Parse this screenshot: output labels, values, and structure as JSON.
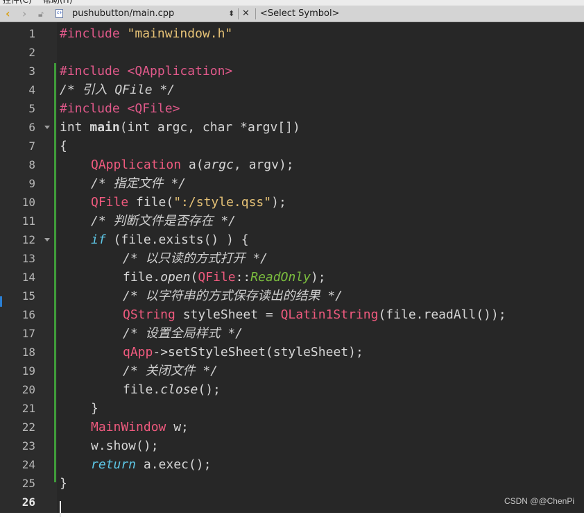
{
  "menu": [
    "控件(C)",
    "帮助(H)"
  ],
  "toolbar": {
    "file_name": "pushubutton/main.cpp",
    "symbol_selector": "<Select Symbol>"
  },
  "editor": {
    "current_line": 26,
    "lines": [
      {
        "n": 1,
        "parts": [
          [
            "pp",
            "#include "
          ],
          [
            "str",
            "\"mainwindow.h\""
          ]
        ]
      },
      {
        "n": 2,
        "parts": []
      },
      {
        "n": 3,
        "parts": [
          [
            "pp",
            "#include "
          ],
          [
            "pp",
            "<QApplication>"
          ]
        ]
      },
      {
        "n": 4,
        "parts": [
          [
            "cmt",
            "/* 引入 QFile */"
          ]
        ]
      },
      {
        "n": 5,
        "parts": [
          [
            "pp",
            "#include "
          ],
          [
            "pp",
            "<QFile>"
          ]
        ]
      },
      {
        "n": 6,
        "parts": [
          [
            "kw",
            "int "
          ],
          [
            "fn",
            "main"
          ],
          [
            "kw",
            "(int argc, char *argv[])"
          ]
        ]
      },
      {
        "n": 7,
        "parts": [
          [
            "kw",
            "{"
          ]
        ]
      },
      {
        "n": 8,
        "indent": 1,
        "parts": [
          [
            "cls",
            "QApplication"
          ],
          [
            "kw",
            " a("
          ],
          [
            "ital",
            "argc"
          ],
          [
            "kw",
            ", argv);"
          ]
        ]
      },
      {
        "n": 9,
        "indent": 1,
        "parts": [
          [
            "cmt",
            "/* 指定文件 */"
          ]
        ]
      },
      {
        "n": 10,
        "indent": 1,
        "parts": [
          [
            "cls",
            "QFile"
          ],
          [
            "kw",
            " file("
          ],
          [
            "str",
            "\":/style.qss\""
          ],
          [
            "kw",
            ");"
          ]
        ]
      },
      {
        "n": 11,
        "indent": 1,
        "parts": [
          [
            "cmt",
            "/* 判断文件是否存在 */"
          ]
        ]
      },
      {
        "n": 12,
        "indent": 1,
        "parts": [
          [
            "ctl",
            "if"
          ],
          [
            "kw",
            " (file.exists() ) {"
          ]
        ]
      },
      {
        "n": 13,
        "indent": 2,
        "parts": [
          [
            "cmt",
            "/* 以只读的方式打开 */"
          ]
        ]
      },
      {
        "n": 14,
        "indent": 2,
        "parts": [
          [
            "kw",
            "file."
          ],
          [
            "ital",
            "open"
          ],
          [
            "kw",
            "("
          ],
          [
            "cls",
            "QFile"
          ],
          [
            "kw",
            "::"
          ],
          [
            "enum",
            "ReadOnly"
          ],
          [
            "kw",
            ");"
          ]
        ]
      },
      {
        "n": 15,
        "indent": 2,
        "parts": [
          [
            "cmt",
            "/* 以字符串的方式保存读出的结果 */"
          ]
        ]
      },
      {
        "n": 16,
        "indent": 2,
        "parts": [
          [
            "cls",
            "QString"
          ],
          [
            "kw",
            " styleSheet = "
          ],
          [
            "cls",
            "QLatin1String"
          ],
          [
            "kw",
            "(file.readAll());"
          ]
        ]
      },
      {
        "n": 17,
        "indent": 2,
        "parts": [
          [
            "cmt",
            "/* 设置全局样式 */"
          ]
        ]
      },
      {
        "n": 18,
        "indent": 2,
        "parts": [
          [
            "cls",
            "qApp"
          ],
          [
            "kw",
            "->setStyleSheet(styleSheet);"
          ]
        ]
      },
      {
        "n": 19,
        "indent": 2,
        "parts": [
          [
            "cmt",
            "/* 关闭文件 */"
          ]
        ]
      },
      {
        "n": 20,
        "indent": 2,
        "parts": [
          [
            "kw",
            "file."
          ],
          [
            "ital",
            "close"
          ],
          [
            "kw",
            "();"
          ]
        ]
      },
      {
        "n": 21,
        "indent": 1,
        "parts": [
          [
            "kw",
            "}"
          ]
        ]
      },
      {
        "n": 22,
        "indent": 1,
        "parts": [
          [
            "cls",
            "MainWindow"
          ],
          [
            "kw",
            " w;"
          ]
        ]
      },
      {
        "n": 23,
        "indent": 1,
        "parts": [
          [
            "kw",
            "w.show();"
          ]
        ]
      },
      {
        "n": 24,
        "indent": 1,
        "parts": [
          [
            "ctl",
            "return"
          ],
          [
            "kw",
            " a.exec();"
          ]
        ]
      },
      {
        "n": 25,
        "parts": [
          [
            "kw",
            "}"
          ]
        ]
      },
      {
        "n": 26,
        "parts": []
      }
    ],
    "fold_lines": [
      6,
      12
    ]
  },
  "watermark": "CSDN @@ChenPi"
}
